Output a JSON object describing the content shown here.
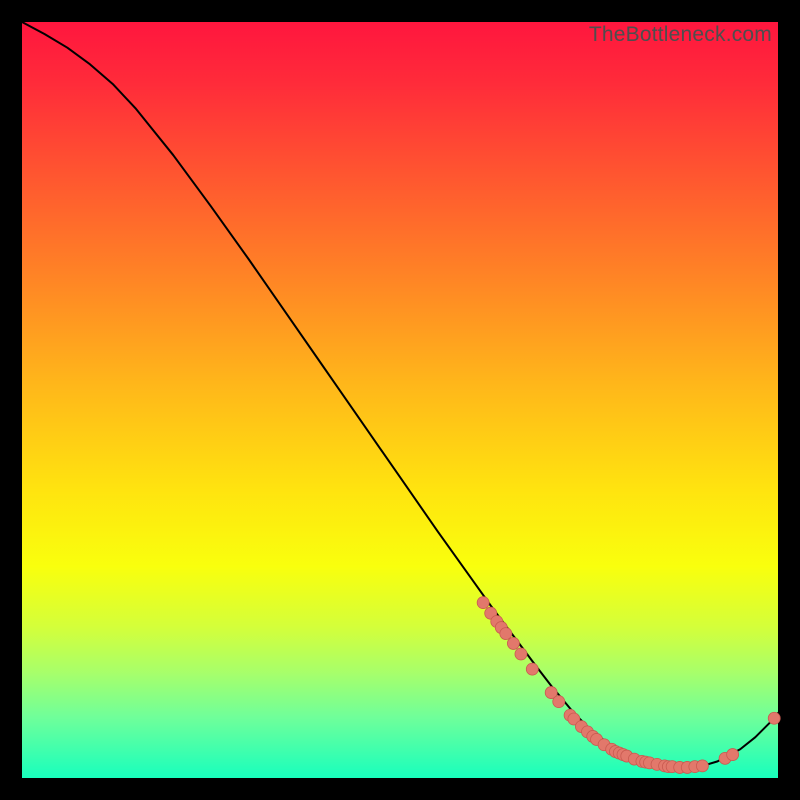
{
  "watermark": "TheBottleneck.com",
  "chart_data": {
    "type": "line",
    "title": "",
    "xlabel": "",
    "ylabel": "",
    "xlim": [
      0,
      100
    ],
    "ylim": [
      0,
      100
    ],
    "grid": false,
    "series": [
      {
        "name": "curve",
        "x": [
          0,
          3,
          6,
          9,
          12,
          15,
          20,
          25,
          30,
          35,
          40,
          45,
          50,
          55,
          60,
          62,
          65,
          68,
          70,
          73,
          75,
          78,
          80,
          82,
          85,
          88,
          90,
          92,
          95,
          97,
          99,
          100
        ],
        "y": [
          100,
          98.4,
          96.6,
          94.4,
          91.8,
          88.6,
          82.4,
          75.6,
          68.6,
          61.4,
          54.2,
          47.0,
          39.8,
          32.6,
          25.6,
          22.8,
          18.8,
          14.8,
          12.2,
          8.6,
          6.6,
          4.2,
          3.0,
          2.2,
          1.6,
          1.4,
          1.6,
          2.2,
          3.8,
          5.4,
          7.4,
          8.6
        ]
      }
    ],
    "markers": {
      "name": "highlight-points",
      "x": [
        61.0,
        62.0,
        62.8,
        63.4,
        64.0,
        65.0,
        66.0,
        67.5,
        70.0,
        71.0,
        72.5,
        73.0,
        74.0,
        74.8,
        75.5,
        76.0,
        77.0,
        78.0,
        78.5,
        79.0,
        79.5,
        80.0,
        81.0,
        82.0,
        82.5,
        83.0,
        84.0,
        85.0,
        85.5,
        86.0,
        87.0,
        88.0,
        89.0,
        90.0,
        93.0,
        94.0,
        99.5
      ],
      "y": [
        23.2,
        21.8,
        20.7,
        19.9,
        19.1,
        17.8,
        16.4,
        14.4,
        11.3,
        10.1,
        8.3,
        7.8,
        6.8,
        6.1,
        5.5,
        5.1,
        4.4,
        3.8,
        3.5,
        3.3,
        3.1,
        2.9,
        2.5,
        2.2,
        2.1,
        2.0,
        1.8,
        1.6,
        1.5,
        1.5,
        1.4,
        1.4,
        1.5,
        1.6,
        2.6,
        3.1,
        7.9
      ]
    }
  }
}
